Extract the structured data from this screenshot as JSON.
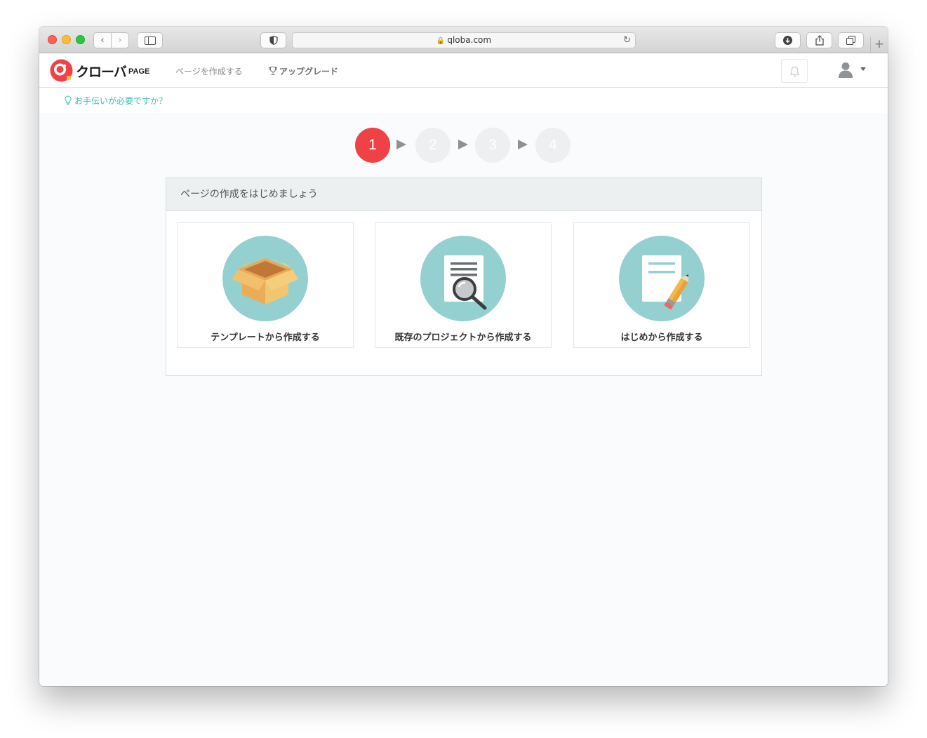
{
  "browser": {
    "url": "qloba.com",
    "back_icon": "chevron-left-icon",
    "forward_icon": "chevron-right-icon"
  },
  "header": {
    "logo_text": "クローバ",
    "logo_sub": "PAGE",
    "nav": {
      "create_page": "ページを作成する",
      "upgrade": "アップグレード"
    }
  },
  "help": {
    "text": "お手伝いが必要ですか？"
  },
  "steps": {
    "items": [
      "1",
      "2",
      "3",
      "4"
    ],
    "active_index": 0,
    "active_color": "#ef4146",
    "inactive_color": "#edeff0"
  },
  "panel": {
    "title": "ページの作成をはじめましょう",
    "options": [
      {
        "label": "テンプレートから作成する",
        "icon": "box-icon"
      },
      {
        "label": "既存のプロジェクトから作成する",
        "icon": "document-search-icon"
      },
      {
        "label": "はじめから作成する",
        "icon": "document-pencil-icon"
      }
    ]
  },
  "colors": {
    "accent_teal": "#3fbfb3",
    "icon_circle": "#94d0cf",
    "brand_red": "#ef4146"
  }
}
